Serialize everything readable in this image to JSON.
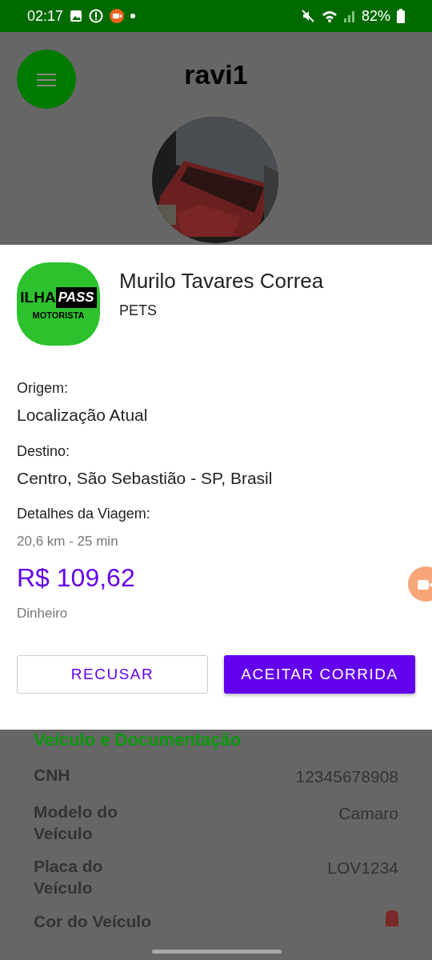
{
  "status_bar": {
    "time": "02:17",
    "battery": "82%"
  },
  "header": {
    "title": "ravi1"
  },
  "ride_request": {
    "logo": {
      "word_1": "ILHA",
      "word_2": "PASS",
      "subtitle": "MOTORISTA"
    },
    "passenger": "Murilo Tavares Correa",
    "category": "PETS",
    "fields": [
      {
        "label": "Origem:",
        "value": "Localização Atual"
      },
      {
        "label": "Destino:",
        "value": "Centro, São Sebastião - SP, Brasil"
      }
    ],
    "details": {
      "label": "Detalhes da Viagem:",
      "distance_time": "20,6 km - 25 min",
      "price": "R$ 109,62",
      "payment": "Dinheiro"
    },
    "buttons": [
      {
        "label": "RECUSAR",
        "kind": "outline"
      },
      {
        "label": "ACEITAR CORRIDA",
        "kind": "primary"
      }
    ]
  },
  "profile": {
    "section_title": "Veículo e Documentação",
    "rows": [
      {
        "label": "CNH",
        "kind": "text",
        "value": "12345678908"
      },
      {
        "label": "Modelo do Veículo",
        "kind": "text",
        "value": "Camaro"
      },
      {
        "label": "Placa do Veículo",
        "kind": "text",
        "value": "LOV1234"
      },
      {
        "label": "Cor do Veículo",
        "kind": "swatch",
        "color": "#7a2a2a"
      }
    ]
  }
}
